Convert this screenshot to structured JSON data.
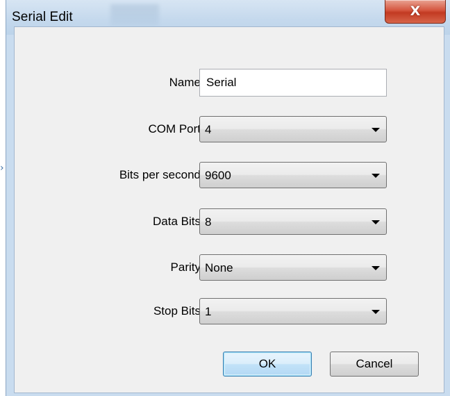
{
  "window": {
    "title": "Serial Edit",
    "close_glyph": "X"
  },
  "form": {
    "name": {
      "label": "Name",
      "value": "Serial"
    },
    "com_port": {
      "label": "COM Port",
      "value": "4"
    },
    "bits_per_second": {
      "label": "Bits per second",
      "value": "9600"
    },
    "data_bits": {
      "label": "Data Bits",
      "value": "8"
    },
    "parity": {
      "label": "Parity",
      "value": "None"
    },
    "stop_bits": {
      "label": "Stop Bits",
      "value": "1"
    }
  },
  "buttons": {
    "ok_label": "OK",
    "cancel_label": "Cancel"
  },
  "colors": {
    "title_bar": "#c5d9ed",
    "client": "#f0f0f0",
    "close_button": "#c9462e",
    "default_button_border": "#3c7fb1"
  },
  "icons": {
    "dropdown": "triangle-down",
    "close": "x-mark"
  }
}
